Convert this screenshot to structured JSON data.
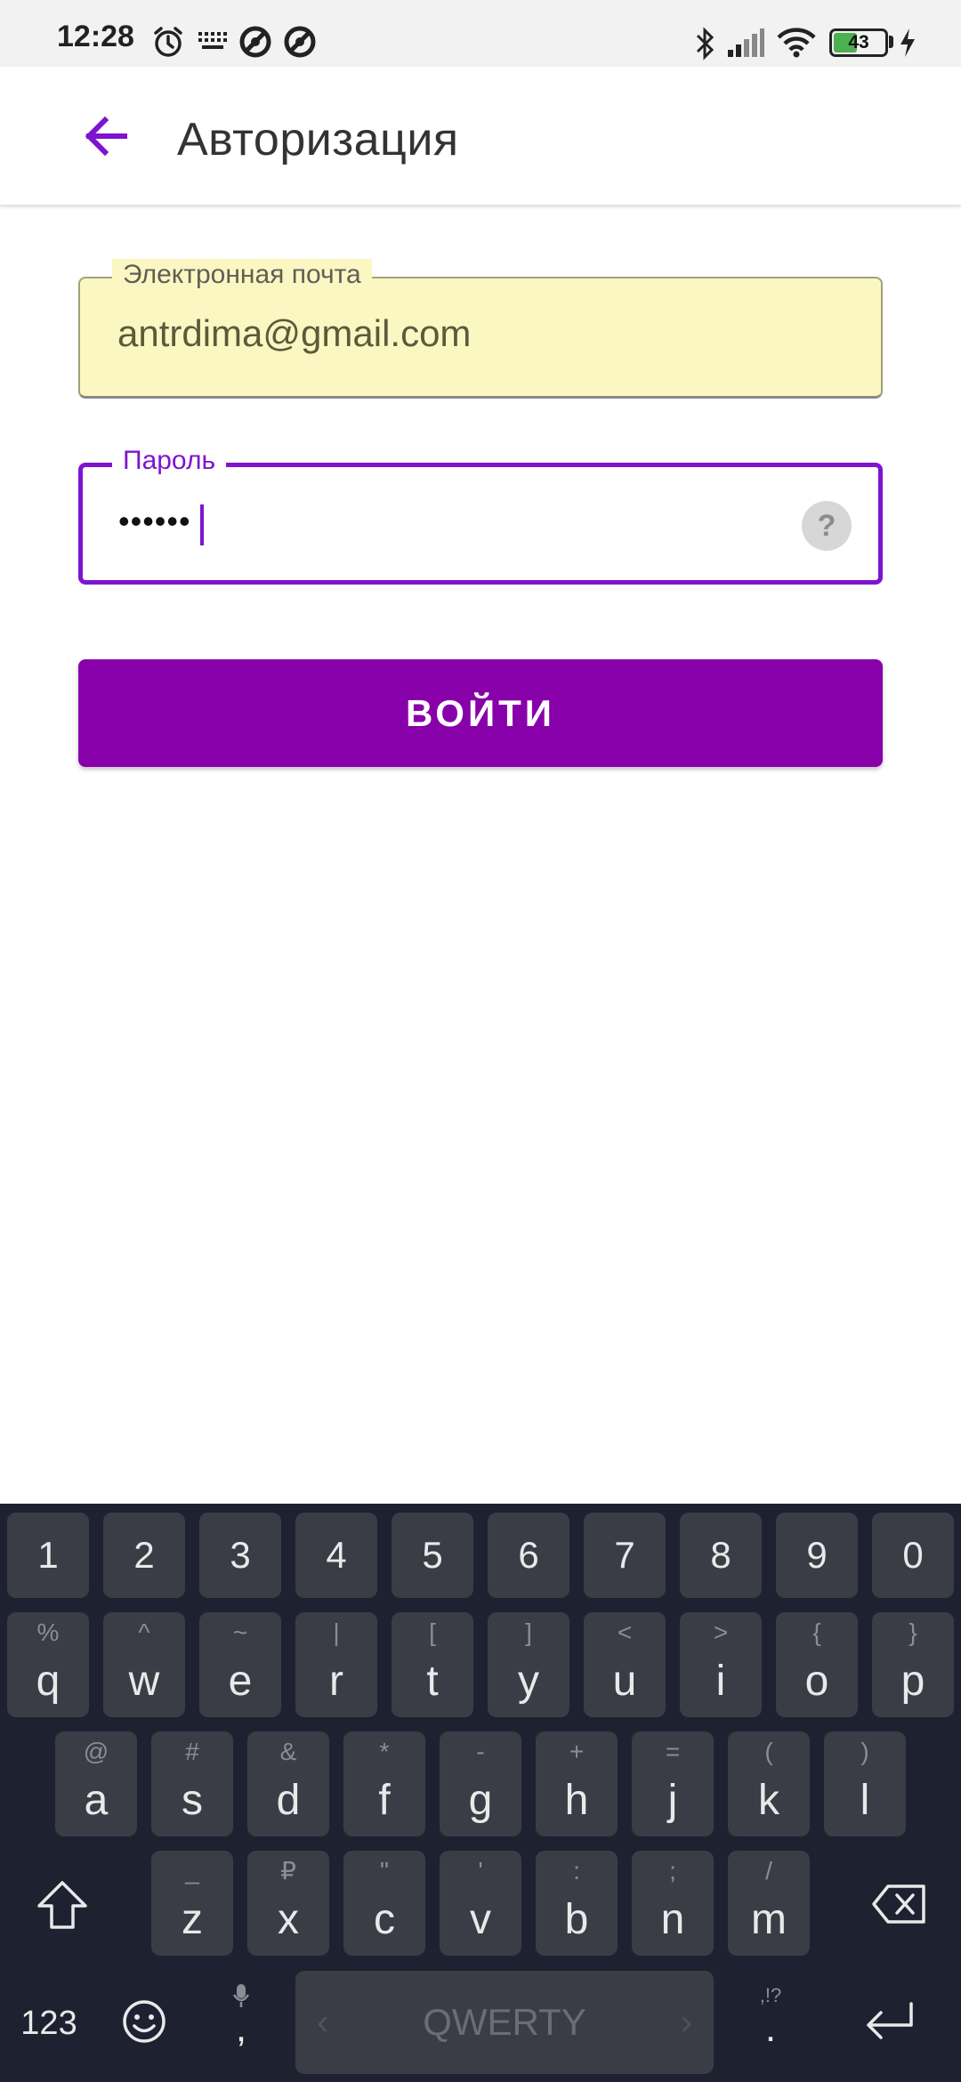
{
  "status_bar": {
    "time": "12:28",
    "battery_level": "43",
    "icons": [
      "alarm-icon",
      "keyboard-icon",
      "sync-icon",
      "sync-icon",
      "bluetooth-icon",
      "signal-icon",
      "wifi-icon",
      "battery-icon",
      "charging-icon"
    ]
  },
  "app_bar": {
    "back_icon": "arrow-left-icon",
    "title": "Авторизация"
  },
  "form": {
    "email_label": "Электронная почта",
    "email_value": "antrdima@gmail.com",
    "password_label": "Пароль",
    "password_value": "••••••",
    "help_icon": "?",
    "login_label": "ВОЙТИ"
  },
  "colors": {
    "accent": "#7e14cf",
    "button": "#8800aa",
    "autofill_bg": "#fbf7c2",
    "keyboard_bg": "#1e2230",
    "key_bg": "#3a3d46"
  },
  "keyboard": {
    "numbers": [
      "1",
      "2",
      "3",
      "4",
      "5",
      "6",
      "7",
      "8",
      "9",
      "0"
    ],
    "row1": [
      {
        "main": "q",
        "hint": "%"
      },
      {
        "main": "w",
        "hint": "^"
      },
      {
        "main": "e",
        "hint": "~"
      },
      {
        "main": "r",
        "hint": "|"
      },
      {
        "main": "t",
        "hint": "["
      },
      {
        "main": "y",
        "hint": "]"
      },
      {
        "main": "u",
        "hint": "<"
      },
      {
        "main": "i",
        "hint": ">"
      },
      {
        "main": "o",
        "hint": "{"
      },
      {
        "main": "p",
        "hint": "}"
      }
    ],
    "row2": [
      {
        "main": "a",
        "hint": "@"
      },
      {
        "main": "s",
        "hint": "#"
      },
      {
        "main": "d",
        "hint": "&"
      },
      {
        "main": "f",
        "hint": "*"
      },
      {
        "main": "g",
        "hint": "-"
      },
      {
        "main": "h",
        "hint": "+"
      },
      {
        "main": "j",
        "hint": "="
      },
      {
        "main": "k",
        "hint": "("
      },
      {
        "main": "l",
        "hint": ")"
      }
    ],
    "row3": [
      {
        "main": "z",
        "hint": "_"
      },
      {
        "main": "x",
        "hint": "₽"
      },
      {
        "main": "c",
        "hint": "\""
      },
      {
        "main": "v",
        "hint": "'"
      },
      {
        "main": "b",
        "hint": ":"
      },
      {
        "main": "n",
        "hint": ";"
      },
      {
        "main": "m",
        "hint": "/"
      }
    ],
    "symbols_key": "123",
    "comma_key": ",",
    "period_key": ".",
    "period_hint": ",!?",
    "space_label": "QWERTY"
  }
}
